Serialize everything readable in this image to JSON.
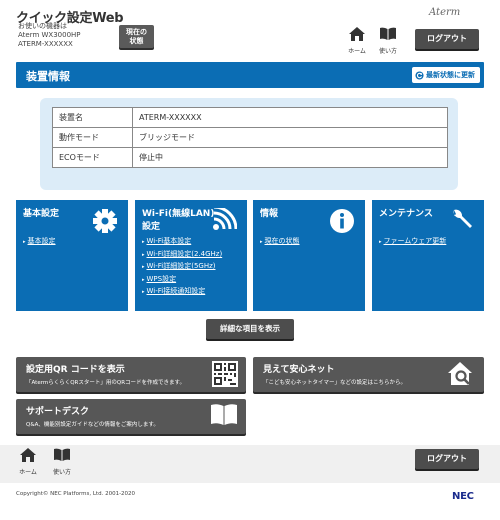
{
  "header": {
    "app_title": "クイック設定Web",
    "device_caption": "お使いの機器は",
    "device_model": "Aterm WX3000HP",
    "device_name": "ATERM-XXXXXX",
    "status_button": [
      "現在の",
      "状態"
    ],
    "logo": "Aterm",
    "home_label": "ホーム",
    "howto_label": "使い方",
    "logout_label": "ログアウト"
  },
  "section": {
    "title": "装置情報",
    "refresh_label": "最新状態に更新"
  },
  "device_info": [
    {
      "key": "装置名",
      "value": "ATERM-XXXXXX"
    },
    {
      "key": "動作モード",
      "value": "ブリッジモード"
    },
    {
      "key": "ECOモード",
      "value": "停止中"
    }
  ],
  "cards": [
    {
      "title": [
        "基本設定"
      ],
      "icon": "gear-icon",
      "links": [
        "基本設定"
      ]
    },
    {
      "title": [
        "Wi-Fi(無線LAN)",
        "設定"
      ],
      "icon": "wifi-icon",
      "links": [
        "Wi-Fi基本設定",
        "Wi-Fi詳細設定(2.4GHz)",
        "Wi-Fi詳細設定(5GHz)",
        "WPS設定",
        "Wi-Fi接続通知設定"
      ]
    },
    {
      "title": [
        "情報"
      ],
      "icon": "info-icon",
      "links": [
        "現在の状態"
      ]
    },
    {
      "title": [
        "メンテナンス"
      ],
      "icon": "wrench-icon",
      "links": [
        "ファームウェア更新"
      ]
    }
  ],
  "detail_button": "詳細な項目を表示",
  "shortcuts": [
    {
      "title": "設定用QR コードを表示",
      "desc": "「AtermらくらくQRスタート」用のQRコードを作成できます。",
      "icon": "qr-code-icon"
    },
    {
      "title": "見えて安心ネット",
      "desc": "「こども安心ネットタイマー」などの設定はこちらから。",
      "icon": "home-search-icon"
    },
    {
      "title": "サポートデスク",
      "desc": "Q&A、機能別設定ガイドなどの情報をご案内します。",
      "icon": "book-icon"
    }
  ],
  "footer": {
    "home_label": "ホーム",
    "howto_label": "使い方",
    "logout_label": "ログアウト",
    "copyright": "Copyright© NEC Platforms, Ltd. 2001-2020",
    "brand": "NEC"
  },
  "colors": {
    "primary": "#0b6db4",
    "panel": "#dcecf8",
    "button": "#4d4d4d"
  }
}
